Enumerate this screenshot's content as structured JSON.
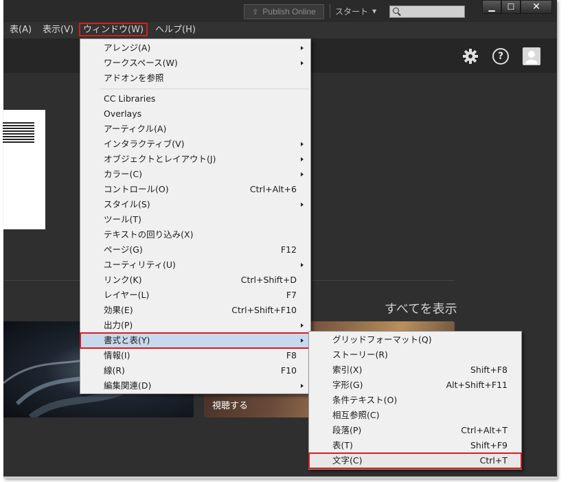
{
  "titlebar": {
    "publish_label": "Publish Online",
    "workspace_label": "スタート",
    "search_placeholder": "",
    "minimize_glyph": "▁",
    "maximize_glyph": "☐",
    "close_glyph": "✕"
  },
  "menubar": {
    "items": [
      {
        "label": "表(A)"
      },
      {
        "label": "表示(V)"
      },
      {
        "label": "ウィンドウ(W)"
      },
      {
        "label": "ヘルプ(H)"
      }
    ]
  },
  "toolbar": {
    "help_glyph": "?"
  },
  "content": {
    "see_all": "すべてを表示",
    "watch": "視聴する"
  },
  "window_menu": {
    "items": [
      {
        "label": "アレンジ(A)",
        "shortcut": "",
        "submenu": true
      },
      {
        "label": "ワークスペース(W)",
        "shortcut": "",
        "submenu": true
      },
      {
        "label": "アドオンを参照",
        "shortcut": "",
        "submenu": false
      },
      {
        "label": "CC Libraries",
        "shortcut": "",
        "submenu": false
      },
      {
        "label": "Overlays",
        "shortcut": "",
        "submenu": false
      },
      {
        "label": "アーティクル(A)",
        "shortcut": "",
        "submenu": false
      },
      {
        "label": "インタラクティブ(V)",
        "shortcut": "",
        "submenu": true
      },
      {
        "label": "オブジェクトとレイアウト(J)",
        "shortcut": "",
        "submenu": true
      },
      {
        "label": "カラー(C)",
        "shortcut": "",
        "submenu": true
      },
      {
        "label": "コントロール(O)",
        "shortcut": "Ctrl+Alt+6",
        "submenu": false
      },
      {
        "label": "スタイル(S)",
        "shortcut": "",
        "submenu": true
      },
      {
        "label": "ツール(T)",
        "shortcut": "",
        "submenu": false
      },
      {
        "label": "テキストの回り込み(X)",
        "shortcut": "",
        "submenu": false
      },
      {
        "label": "ページ(G)",
        "shortcut": "F12",
        "submenu": false
      },
      {
        "label": "ユーティリティ(U)",
        "shortcut": "",
        "submenu": true
      },
      {
        "label": "リンク(K)",
        "shortcut": "Ctrl+Shift+D",
        "submenu": false
      },
      {
        "label": "レイヤー(L)",
        "shortcut": "F7",
        "submenu": false
      },
      {
        "label": "効果(E)",
        "shortcut": "Ctrl+Shift+F10",
        "submenu": false
      },
      {
        "label": "出力(P)",
        "shortcut": "",
        "submenu": true
      },
      {
        "label": "書式と表(Y)",
        "shortcut": "",
        "submenu": true
      },
      {
        "label": "情報(I)",
        "shortcut": "F8",
        "submenu": false
      },
      {
        "label": "線(R)",
        "shortcut": "F10",
        "submenu": false
      },
      {
        "label": "編集関連(D)",
        "shortcut": "",
        "submenu": true
      }
    ]
  },
  "type_menu": {
    "items": [
      {
        "label": "グリッドフォーマット(Q)",
        "shortcut": ""
      },
      {
        "label": "ストーリー(R)",
        "shortcut": ""
      },
      {
        "label": "索引(X)",
        "shortcut": "Shift+F8"
      },
      {
        "label": "字形(G)",
        "shortcut": "Alt+Shift+F11"
      },
      {
        "label": "条件テキスト(O)",
        "shortcut": ""
      },
      {
        "label": "相互参照(C)",
        "shortcut": ""
      },
      {
        "label": "段落(P)",
        "shortcut": "Ctrl+Alt+T"
      },
      {
        "label": "表(T)",
        "shortcut": "Shift+F9"
      },
      {
        "label": "文字(C)",
        "shortcut": "Ctrl+T"
      }
    ]
  },
  "colors": {
    "highlight_outline": "#d21f1f",
    "app_background": "#2f2f2f",
    "menu_background": "#f0f0f0"
  }
}
